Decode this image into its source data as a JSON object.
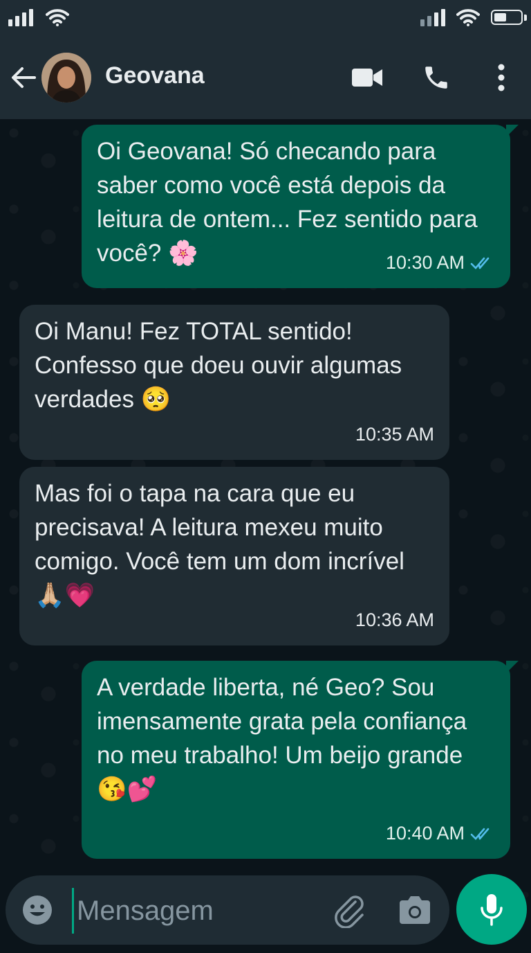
{
  "contact": {
    "name": "Geovana"
  },
  "messages": [
    {
      "direction": "out",
      "text": "Oi Geovana! Só checando para saber como você está depois da leitura de ontem... Fez sentido para você? 🌸",
      "time": "10:30 AM",
      "status": "read"
    },
    {
      "direction": "in",
      "text": "Oi Manu! Fez TOTAL sentido! Confesso que doeu ouvir algumas verdades 🥺",
      "time": "10:35 AM"
    },
    {
      "direction": "in",
      "text": "Mas foi o tapa na cara que eu precisava! A leitura mexeu muito comigo. Você tem um dom incrível 🙏🏼💗",
      "time": "10:36 AM"
    },
    {
      "direction": "out",
      "text": "A verdade liberta, né Geo? Sou imensamente grata pela confiança no meu trabalho! Um beijo grande 😘💕",
      "time": "10:40 AM",
      "status": "read"
    }
  ],
  "input": {
    "placeholder": "Mensagem"
  },
  "icons": {
    "back": "arrow-left-icon",
    "video": "video-camera-icon",
    "call": "phone-icon",
    "menu": "more-vertical-icon",
    "emoji": "smiley-icon",
    "attach": "paperclip-icon",
    "camera": "camera-icon",
    "mic": "microphone-icon",
    "read": "double-check-icon"
  },
  "colors": {
    "outgoing_bubble": "#005c4b",
    "incoming_bubble": "#202c33",
    "header": "#1f2c34",
    "accent": "#00a884",
    "read_ticks": "#53bdeb",
    "background": "#0b141a"
  }
}
